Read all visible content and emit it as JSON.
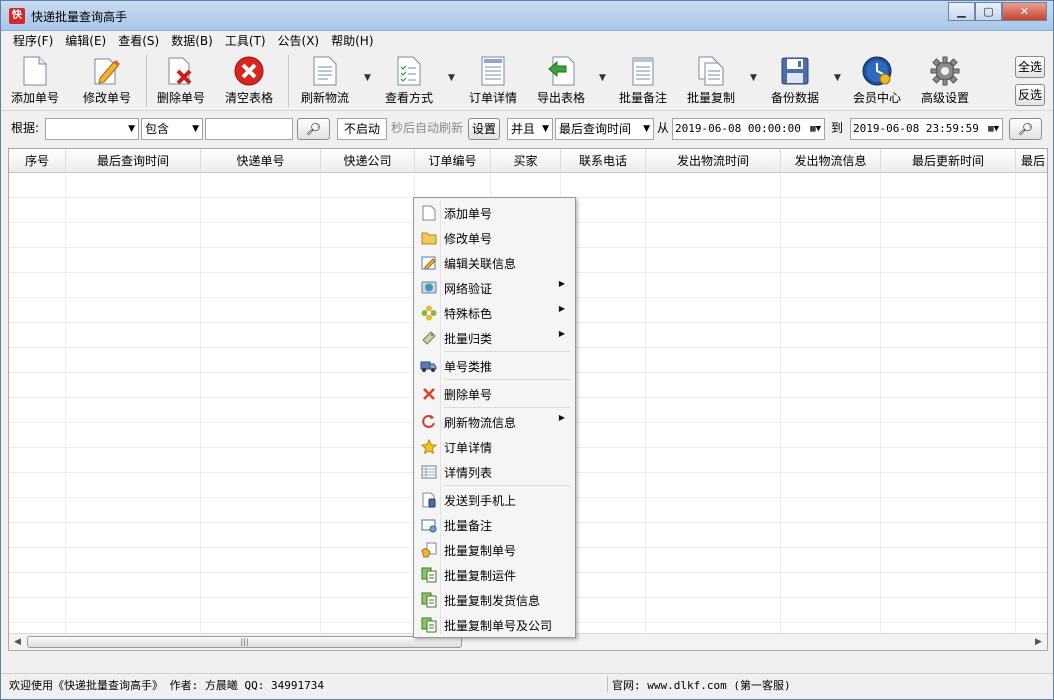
{
  "window": {
    "title": "快递批量查询高手"
  },
  "menu": [
    "程序(F)",
    "编辑(E)",
    "查看(S)",
    "数据(B)",
    "工具(T)",
    "公告(X)",
    "帮助(H)"
  ],
  "toolbar": {
    "add": "添加单号",
    "edit": "修改单号",
    "delete": "删除单号",
    "clear": "清空表格",
    "refresh": "刷新物流",
    "view_mode": "查看方式",
    "order_detail": "订单详情",
    "export": "导出表格",
    "batch_note": "批量备注",
    "batch_copy": "批量复制",
    "backup": "备份数据",
    "member": "会员中心",
    "advanced": "高级设置",
    "select_all": "全选",
    "invert": "反选"
  },
  "filter": {
    "label": "根据:",
    "field_value": "",
    "match_value": "包含",
    "keyword": "",
    "auto_refresh": "不启动",
    "auto_refresh_hint": "秒后自动刷新",
    "settings": "设置",
    "logic": "并且",
    "time_field": "最后查询时间",
    "from_label": "从",
    "from_value": "2019-06-08 00:00:00",
    "to_label": "到",
    "to_value": "2019-06-08 23:59:59"
  },
  "columns": [
    "序号",
    "最后查询时间",
    "快递单号",
    "快递公司",
    "订单编号",
    "买家",
    "联系电话",
    "发出物流时间",
    "发出物流信息",
    "最后更新时间",
    "最后"
  ],
  "context_menu": [
    {
      "label": "添加单号",
      "icon": "blank-page-icon"
    },
    {
      "label": "修改单号",
      "icon": "folder-icon"
    },
    {
      "label": "编辑关联信息",
      "icon": "edit-form-icon"
    },
    {
      "label": "网络验证",
      "icon": "globe-icon",
      "submenu": true
    },
    {
      "label": "特殊标色",
      "icon": "color-flower-icon",
      "submenu": true
    },
    {
      "label": "批量归类",
      "icon": "tag-icon",
      "submenu": true
    },
    {
      "label": "单号类推",
      "icon": "truck-icon"
    },
    {
      "label": "删除单号",
      "icon": "red-x-icon"
    },
    {
      "label": "刷新物流信息",
      "icon": "refresh-icon",
      "submenu": true
    },
    {
      "label": "订单详情",
      "icon": "star-icon"
    },
    {
      "label": "详情列表",
      "icon": "list-icon"
    },
    {
      "label": "发送到手机上",
      "icon": "phone-icon"
    },
    {
      "label": "批量备注",
      "icon": "note-icon"
    },
    {
      "label": "批量复制单号",
      "icon": "copy-hand-icon"
    },
    {
      "label": "批量复制运件",
      "icon": "copy-icon"
    },
    {
      "label": "批量复制发货信息",
      "icon": "copy-icon"
    },
    {
      "label": "批量复制单号及公司",
      "icon": "copy-icon"
    }
  ],
  "status": {
    "left": "欢迎使用《快递批量查询高手》 作者: 方晨曦  QQ: 34991734",
    "right": "官网: www.dlkf.com  (第一客服)"
  },
  "colors": {
    "title_bar": "#b9d1ee",
    "close_button": "#c7432e",
    "grid_line": "#ededed"
  }
}
